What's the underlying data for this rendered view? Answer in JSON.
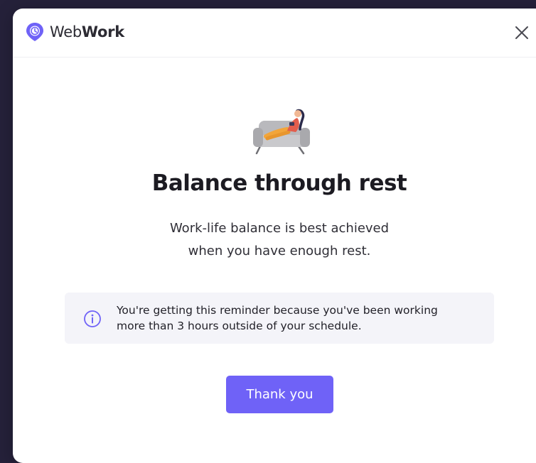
{
  "header": {
    "logo_text_light": "Web",
    "logo_text_bold": "Work",
    "logo_icon": "clock-pin-icon",
    "close_icon": "close-icon"
  },
  "main": {
    "illustration": "person-resting-on-sofa-illustration",
    "title": "Balance through rest",
    "subtitle_line1": "Work-life balance is best achieved",
    "subtitle_line2": "when you have enough rest."
  },
  "info": {
    "icon": "info-icon",
    "line1": "You're getting this reminder because you've been working",
    "line2": "more than 3 hours outside of your schedule."
  },
  "actions": {
    "thank_you_label": "Thank you"
  },
  "colors": {
    "accent": "#6f62f7",
    "info_bg": "#f4f4f9",
    "backdrop": "#25213a"
  }
}
